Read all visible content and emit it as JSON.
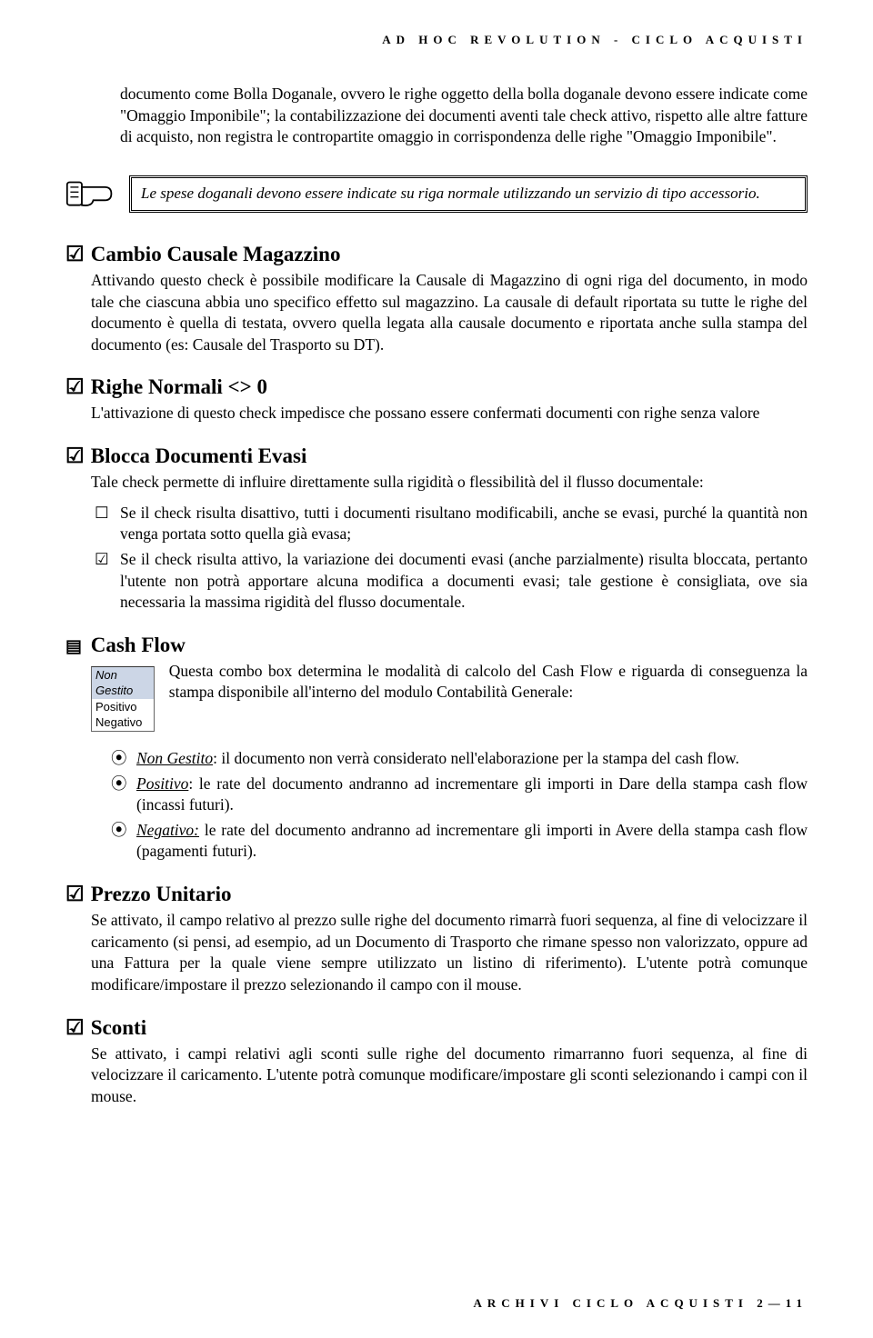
{
  "header": {
    "running": "AD HOC REVOLUTION - CICLO ACQUISTI"
  },
  "intro_paragraph": "documento come Bolla Doganale, ovvero le righe oggetto della bolla doganale devono essere indicate come \"Omaggio Imponibile\"; la contabilizzazione dei documenti aventi tale check attivo, rispetto alle altre fatture di acquisto, non registra le contropartite omaggio in corrispondenza delle righe \"Omaggio Imponibile\".",
  "callout": {
    "text": "Le spese doganali devono essere indicate su riga normale utilizzando un servizio di tipo accessorio."
  },
  "sections": {
    "cambio": {
      "title": "Cambio Causale Magazzino",
      "body": "Attivando questo check è possibile modificare la Causale di Magazzino di ogni riga del documento, in modo tale che ciascuna abbia uno specifico effetto sul magazzino. La causale di default riportata su tutte le righe del documento è quella di testata, ovvero quella legata alla causale documento e riportata anche sulla stampa del documento (es: Causale del Trasporto su DT)."
    },
    "righe": {
      "title": "Righe Normali <> 0",
      "body": "L'attivazione di questo check impedisce che possano essere confermati documenti con righe senza valore"
    },
    "blocca": {
      "title": "Blocca Documenti Evasi",
      "intro": "Tale check permette di influire direttamente sulla rigidità o flessibilità del il flusso documentale:",
      "items": [
        {
          "sym": "☐",
          "text": "Se il check risulta disattivo, tutti i documenti risultano modificabili, anche se evasi, purché la quantità non venga portata sotto quella già evasa;"
        },
        {
          "sym": "☑",
          "text": "Se il check risulta attivo, la variazione dei documenti evasi (anche parzialmente) risulta bloccata, pertanto l'utente non potrà apportare alcuna modifica a documenti evasi; tale gestione è consigliata, ove sia necessaria la massima rigidità del flusso documentale."
        }
      ]
    },
    "cashflow": {
      "title": "Cash Flow",
      "combo": {
        "options": [
          "Non Gestito",
          "Positivo",
          "Negativo"
        ],
        "selected": 0
      },
      "desc": "Questa combo box determina le modalità di calcolo del Cash Flow e riguarda di conseguenza la stampa disponibile all'interno del modulo Contabilità Generale:",
      "items": [
        {
          "label": "Non Gestito",
          "rest": ": il documento non verrà considerato nell'elaborazione per la stampa del cash flow."
        },
        {
          "label": "Positivo",
          "rest": ": le rate del documento andranno ad incrementare gli importi in Dare della stampa cash flow (incassi futuri)."
        },
        {
          "label": "Negativo:",
          "rest": " le rate del documento andranno ad incrementare gli importi in Avere della stampa cash flow (pagamenti futuri)."
        }
      ]
    },
    "prezzo": {
      "title": "Prezzo Unitario",
      "body": "Se attivato, il campo relativo al prezzo sulle righe del documento rimarrà fuori sequenza, al fine di velocizzare il caricamento (si pensi, ad esempio, ad un Documento di Trasporto che rimane spesso non valorizzato, oppure ad una Fattura per la quale viene sempre utilizzato un listino di riferimento). L'utente potrà comunque modificare/impostare il prezzo selezionando il campo con il mouse."
    },
    "sconti": {
      "title": "Sconti",
      "body": "Se attivato, i campi relativi agli sconti sulle righe del documento rimarranno fuori sequenza, al fine di velocizzare il caricamento. L'utente potrà comunque modificare/impostare gli sconti selezionando i campi con il mouse."
    }
  },
  "footer": {
    "text": "ARCHIVI CICLO ACQUISTI  2—11"
  }
}
